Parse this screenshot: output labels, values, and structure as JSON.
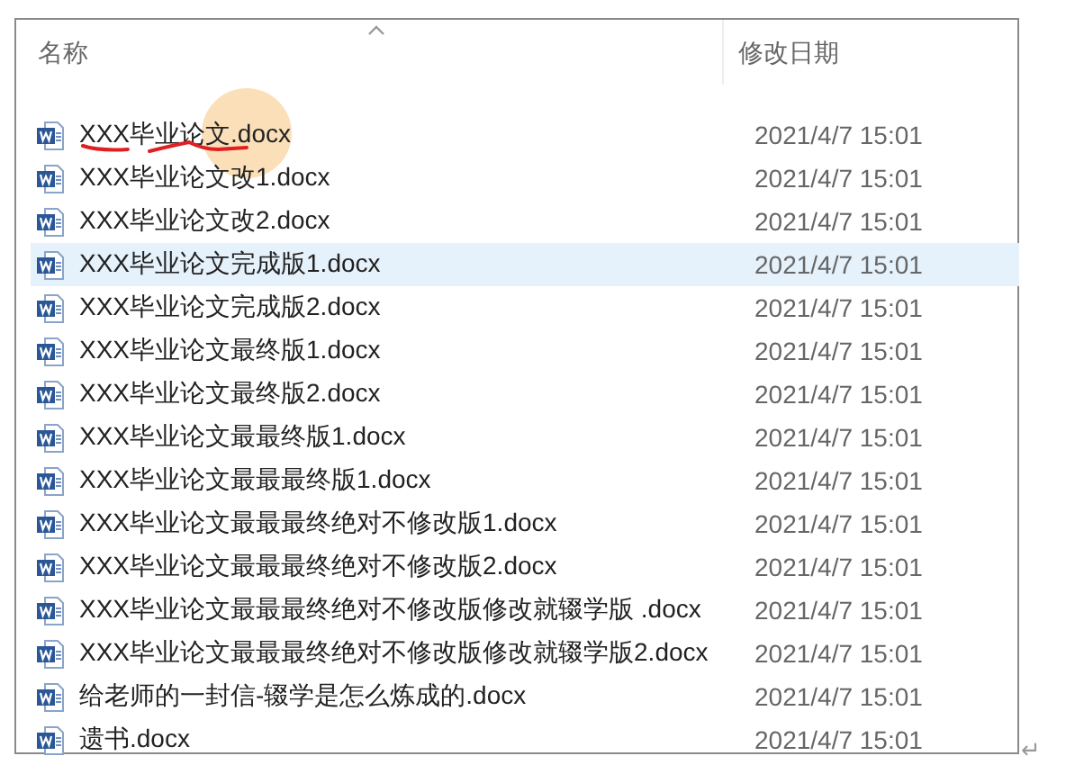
{
  "columns": [
    "名称",
    "修改日期"
  ],
  "sort": {
    "ascending": true
  },
  "files": [
    {
      "name": "XXX毕业论文.docx",
      "date": "2021/4/7 15:01",
      "selected": false,
      "annotated": true
    },
    {
      "name": "XXX毕业论文改1.docx",
      "date": "2021/4/7 15:01",
      "selected": false,
      "annotated": false
    },
    {
      "name": "XXX毕业论文改2.docx",
      "date": "2021/4/7 15:01",
      "selected": false,
      "annotated": false
    },
    {
      "name": "XXX毕业论文完成版1.docx",
      "date": "2021/4/7 15:01",
      "selected": true,
      "annotated": false
    },
    {
      "name": "XXX毕业论文完成版2.docx",
      "date": "2021/4/7 15:01",
      "selected": false,
      "annotated": false
    },
    {
      "name": "XXX毕业论文最终版1.docx",
      "date": "2021/4/7 15:01",
      "selected": false,
      "annotated": false
    },
    {
      "name": "XXX毕业论文最终版2.docx",
      "date": "2021/4/7 15:01",
      "selected": false,
      "annotated": false
    },
    {
      "name": "XXX毕业论文最最终版1.docx",
      "date": "2021/4/7 15:01",
      "selected": false,
      "annotated": false
    },
    {
      "name": "XXX毕业论文最最最终版1.docx",
      "date": "2021/4/7 15:01",
      "selected": false,
      "annotated": false
    },
    {
      "name": "XXX毕业论文最最最终绝对不修改版1.docx",
      "date": "2021/4/7 15:01",
      "selected": false,
      "annotated": false
    },
    {
      "name": "XXX毕业论文最最最终绝对不修改版2.docx",
      "date": "2021/4/7 15:01",
      "selected": false,
      "annotated": false
    },
    {
      "name": "XXX毕业论文最最最终绝对不修改版修改就辍学版 .docx",
      "date": "2021/4/7 15:01",
      "selected": false,
      "annotated": false
    },
    {
      "name": "XXX毕业论文最最最终绝对不修改版修改就辍学版2.docx",
      "date": "2021/4/7 15:01",
      "selected": false,
      "annotated": false
    },
    {
      "name": "给老师的一封信-辍学是怎么炼成的.docx",
      "date": "2021/4/7 15:01",
      "selected": false,
      "annotated": false
    },
    {
      "name": "遗书.docx",
      "date": "2021/4/7 15:01",
      "selected": false,
      "annotated": false
    }
  ],
  "paragraph_mark": "↵"
}
